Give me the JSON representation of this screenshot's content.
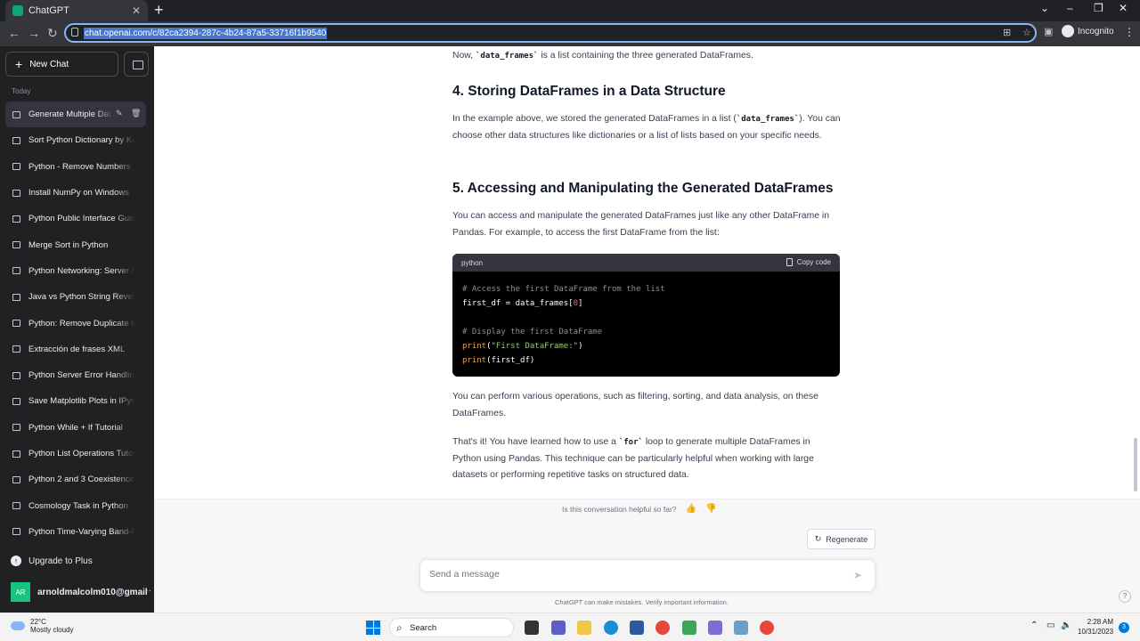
{
  "browser": {
    "tab_title": "ChatGPT",
    "url": "chat.openai.com/c/82ca2394-287c-4b24-87a5-33716f1b9540",
    "incognito_label": "Incognito"
  },
  "sidebar": {
    "new_chat_label": "New Chat",
    "section_label": "Today",
    "items": [
      {
        "label": "Generate Multiple Dat"
      },
      {
        "label": "Sort Python Dictionary by Ke"
      },
      {
        "label": "Python - Remove Numbers"
      },
      {
        "label": "Install NumPy on Windows"
      },
      {
        "label": "Python Public Interface Guid"
      },
      {
        "label": "Merge Sort in Python"
      },
      {
        "label": "Python Networking: Server R"
      },
      {
        "label": "Java vs Python String Revers"
      },
      {
        "label": "Python: Remove Duplicate El"
      },
      {
        "label": "Extracción de frases XML"
      },
      {
        "label": "Python Server Error Handling"
      },
      {
        "label": "Save Matplotlib Plots in IPyth"
      },
      {
        "label": "Python While + If Tutorial"
      },
      {
        "label": "Python List Operations Tutor"
      },
      {
        "label": "Python 2 and 3 Coexistence"
      },
      {
        "label": "Cosmology Task in Python"
      },
      {
        "label": "Python Time-Varying Band-P"
      }
    ],
    "upgrade_label": "Upgrade to Plus",
    "user_initials": "AR",
    "user_name": "arnoldmalcolm010@gmail"
  },
  "content": {
    "line_top_prefix": "Now, ",
    "line_top_code": "`data_frames`",
    "line_top_suffix": " is a list containing the three generated DataFrames.",
    "heading4": "4. Storing DataFrames in a Data Structure",
    "p4_prefix": "In the example above, we stored the generated DataFrames in a list (",
    "p4_code": "`data_frames`",
    "p4_suffix": "). You can choose other data structures like dictionaries or a list of lists based on your specific needs.",
    "heading5": "5. Accessing and Manipulating the Generated DataFrames",
    "p5": "You can access and manipulate the generated DataFrames just like any other DataFrame in Pandas. For example, to access the first DataFrame from the list:",
    "code_lang": "python",
    "copy_label": "Copy code",
    "code_line1": "# Access the first DataFrame from the list",
    "code_line2_a": "first_df = data_frames[",
    "code_line2_num": "0",
    "code_line2_b": "]",
    "code_line4": "# Display the first DataFrame",
    "code_line5_fn": "print",
    "code_line5_a": "(",
    "code_line5_str": "\"First DataFrame:\"",
    "code_line5_b": ")",
    "code_line6_fn": "print",
    "code_line6_a": "(first_df)",
    "p6": "You can perform various operations, such as filtering, sorting, and data analysis, on these DataFrames.",
    "p7_prefix": "That's it! You have learned how to use a ",
    "p7_code": "`for`",
    "p7_suffix": " loop to generate multiple DataFrames in Python using Pandas. This technique can be particularly helpful when working with large datasets or performing repetitive tasks on structured data."
  },
  "footer": {
    "feedback_question": "Is this conversation helpful so far?",
    "regenerate_label": "Regenerate",
    "input_placeholder": "Send a message",
    "disclaimer": "ChatGPT can make mistakes. Verify important information.",
    "help": "?"
  },
  "taskbar": {
    "temperature": "22°C",
    "weather": "Mostly cloudy",
    "search_label": "Search",
    "time": "2:28 AM",
    "date": "10/31/2023",
    "notification_count": "3"
  }
}
